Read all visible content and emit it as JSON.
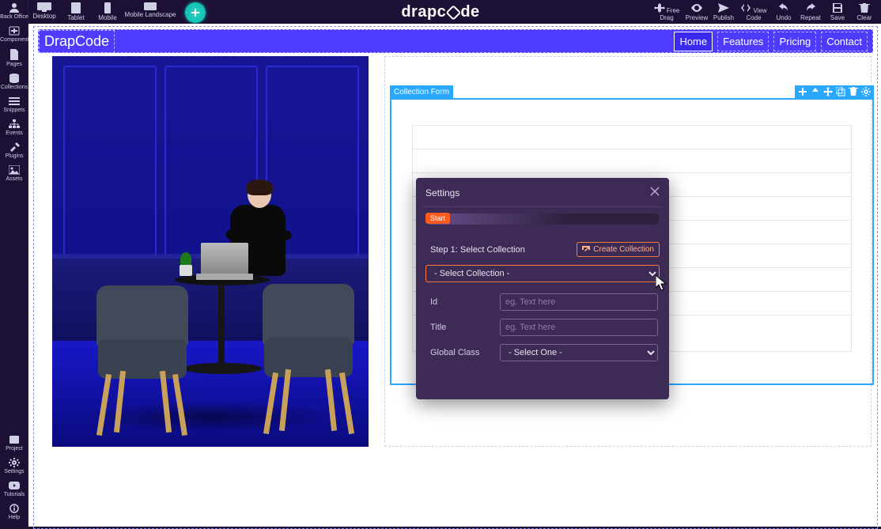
{
  "topbar": {
    "devices": {
      "desktop": "Desktop",
      "tablet": "Tablet",
      "mobile": "Mobile",
      "mobile_landscape": "Mobile Landscape"
    },
    "right": {
      "free_drag": "Free Drag",
      "preview": "Preview",
      "publish": "Publish",
      "view_code": "View Code",
      "undo": "Undo",
      "repeat": "Repeat",
      "save": "Save",
      "clear": "Clear"
    },
    "brand_prefix": "drapc",
    "brand_suffix": "de"
  },
  "leftrail": {
    "back_office": "Back Office",
    "components": "Components",
    "pages": "Pages",
    "collections": "Collections",
    "snippets": "Snippets",
    "events": "Events",
    "plugins": "Plugins",
    "assets": "Assets",
    "project": "Project",
    "settings": "Settings",
    "tutorials": "Tutorials",
    "help": "Help"
  },
  "navbar": {
    "brand": "DrapCode",
    "menu": {
      "home": "Home",
      "features": "Features",
      "pricing": "Pricing",
      "contact": "Contact"
    }
  },
  "colform": {
    "tag": "Collection Form"
  },
  "settings_panel": {
    "title": "Settings",
    "start": "Start",
    "step1": "Step 1: Select Collection",
    "create_collection": "Create Collection",
    "select_collection_placeholder": "- Select Collection -",
    "id_label": "Id",
    "id_placeholder": "eg. Text here",
    "title_label": "Title",
    "title_placeholder": "eg. Text here",
    "gclass_label": "Global Class",
    "gclass_placeholder": "- Select One -"
  }
}
